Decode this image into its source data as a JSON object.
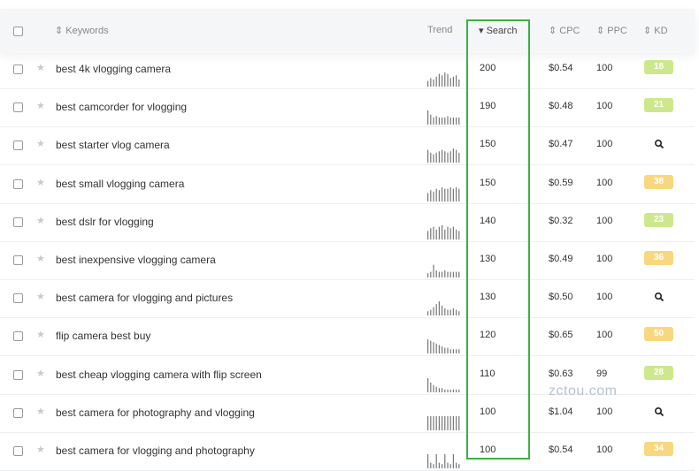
{
  "columns": {
    "keywords": "⇕ Keywords",
    "trend": "Trend",
    "search": "▾ Search",
    "cpc": "⇕ CPC",
    "ppc": "⇕ PPC",
    "kd": "⇕ KD"
  },
  "colors": {
    "kd_green": "#cde88c",
    "kd_yellow": "#f9d77e",
    "highlight": "#3cb043"
  },
  "rows": [
    {
      "keyword": "best 4k vlogging camera",
      "search": "200",
      "cpc": "$0.54",
      "ppc": "100",
      "kd": "18",
      "kd_color": "green",
      "trend": [
        4,
        6,
        5,
        7,
        9,
        8,
        10,
        9,
        6,
        7,
        8,
        5
      ]
    },
    {
      "keyword": "best camcorder for vlogging",
      "search": "190",
      "cpc": "$0.48",
      "ppc": "100",
      "kd": "21",
      "kd_color": "green",
      "trend": [
        10,
        7,
        5,
        6,
        5,
        5,
        5,
        6,
        5,
        5,
        5,
        5
      ]
    },
    {
      "keyword": "best starter vlog camera",
      "search": "150",
      "cpc": "$0.47",
      "ppc": "100",
      "kd": "",
      "kd_color": "search",
      "trend": [
        9,
        7,
        6,
        7,
        8,
        9,
        8,
        7,
        8,
        10,
        9,
        7
      ]
    },
    {
      "keyword": "best small vlogging camera",
      "search": "150",
      "cpc": "$0.59",
      "ppc": "100",
      "kd": "38",
      "kd_color": "yellow",
      "trend": [
        6,
        8,
        7,
        9,
        8,
        10,
        9,
        9,
        10,
        9,
        10,
        9
      ]
    },
    {
      "keyword": "best dslr for vlogging",
      "search": "140",
      "cpc": "$0.32",
      "ppc": "100",
      "kd": "23",
      "kd_color": "green",
      "trend": [
        6,
        8,
        9,
        7,
        9,
        10,
        7,
        9,
        8,
        9,
        7,
        6
      ]
    },
    {
      "keyword": "best inexpensive vlogging camera",
      "search": "130",
      "cpc": "$0.49",
      "ppc": "100",
      "kd": "36",
      "kd_color": "yellow",
      "trend": [
        3,
        4,
        9,
        5,
        4,
        4,
        5,
        4,
        4,
        4,
        4,
        4
      ]
    },
    {
      "keyword": "best camera for vlogging and pictures",
      "search": "130",
      "cpc": "$0.50",
      "ppc": "100",
      "kd": "",
      "kd_color": "search",
      "trend": [
        3,
        4,
        6,
        8,
        10,
        7,
        5,
        4,
        4,
        5,
        4,
        3
      ]
    },
    {
      "keyword": "flip camera best buy",
      "search": "120",
      "cpc": "$0.65",
      "ppc": "100",
      "kd": "50",
      "kd_color": "yellow",
      "trend": [
        10,
        9,
        8,
        7,
        6,
        5,
        4,
        4,
        3,
        3,
        3,
        3
      ]
    },
    {
      "keyword": "best cheap vlogging camera with flip screen",
      "search": "110",
      "cpc": "$0.63",
      "ppc": "99",
      "kd": "28",
      "kd_color": "green",
      "trend": [
        10,
        7,
        5,
        4,
        3,
        3,
        2,
        2,
        2,
        2,
        2,
        2
      ]
    },
    {
      "keyword": "best camera for photography and vlogging",
      "search": "100",
      "cpc": "$1.04",
      "ppc": "100",
      "kd": "",
      "kd_color": "search",
      "trend": [
        10,
        10,
        10,
        10,
        10,
        10,
        10,
        10,
        10,
        10,
        10,
        10
      ]
    },
    {
      "keyword": "best camera for vlogging and photography",
      "search": "100",
      "cpc": "$0.54",
      "ppc": "100",
      "kd": "34",
      "kd_color": "yellow",
      "trend": [
        10,
        4,
        3,
        10,
        4,
        3,
        10,
        4,
        3,
        10,
        4,
        3
      ]
    }
  ],
  "watermark": "zctou.com"
}
